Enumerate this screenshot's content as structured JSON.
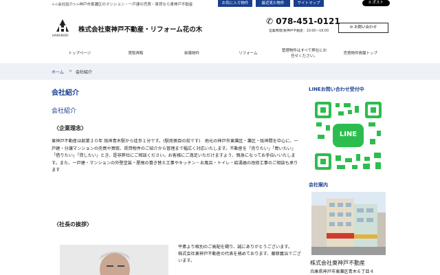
{
  "topbar": {
    "breadcrumb_text": "<<会社紹介>>神戸市東灘区のマンション・一戸建の売買・賃貸なら東神戸不動産",
    "buttons": [
      "お気に入り物件",
      "最近見た物件",
      "サイトマップ"
    ],
    "xpost": "X ポスト"
  },
  "header": {
    "logo_text": "HANANOKI",
    "brand": "株式会社東神戸不動産・リフォーム花の木",
    "phone": "078-451-0121",
    "hours": "営業時間(東神戸不動産：10:00〜19:00",
    "contact": "お問い合わせ"
  },
  "nav": [
    "トップページ",
    "買取再販",
    "新築物件",
    "リフォーム",
    "管理物件はすべて弊社にお任せください。",
    "売買物件情報トップ"
  ],
  "breadcrumb": {
    "home": "ホーム",
    "sep": ">",
    "current": "会社紹介"
  },
  "main": {
    "title": "会社紹介",
    "subtitle": "会社紹介",
    "philosophy_heading": "〈企業理念〉",
    "philosophy_text": "東神戸不動産は創業３０年 阪神青木駅から徒歩１分です。(駅南側目の前です)　地元の神戸市東灘区・灘区・阪神間を中心に、一戸建・分譲マンションの売買や買取、賃貸物件のご紹介から管理まで幅広く対応いたします。不動産を「売りたい」「買いたい」「借りたい」「貸したい」とき、是非弊社にご相談ください。お客様にご満足いただけますよう、親身になってお手伝いいたします。また、一戸建・マンションの外壁塗装・屋根の葺き替え工事やキッチン・お風呂・トイレ・給湯器の改修工事のご相談も承ります",
    "president_heading": "〈社長の挨拶〉",
    "greeting": [
      "平素より格別のご高配を賜り、誠にありがとうございます。",
      "株式会社東神戸不動産の代表を務めております、藤原義治でございます。"
    ]
  },
  "side": {
    "line_heading": "LINEお問い合わせ受付中",
    "line_word": "LINE",
    "company_heading": "会社案内",
    "company_name": "株式会社東神戸不動産",
    "address": "兵庫県神戸市東灘区青木６丁目４"
  },
  "colors": {
    "accent": "#1a3f8f",
    "line_green": "#2dbd4e"
  }
}
